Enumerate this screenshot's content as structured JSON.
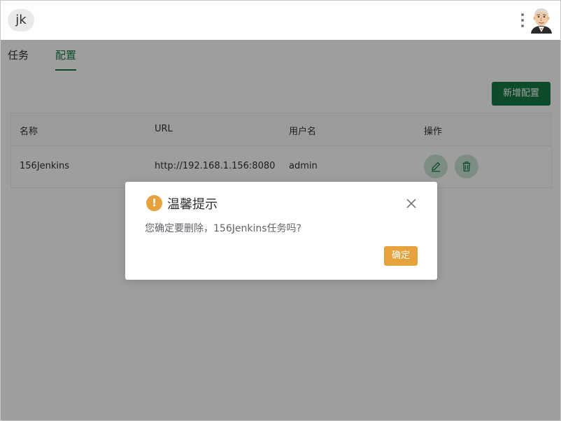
{
  "header": {
    "logo_text": "jk",
    "menu_icon": "vertical-ellipsis-icon",
    "avatar_icon": "jenkins-butler-avatar"
  },
  "tabs": [
    {
      "label": "任务",
      "active": false
    },
    {
      "label": "配置",
      "active": true
    }
  ],
  "toolbar": {
    "add_label": "新增配置"
  },
  "table": {
    "columns": [
      "名称",
      "URL",
      "用户名",
      "操作"
    ],
    "rows": [
      {
        "name": "156Jenkins",
        "url": "http://192.168.1.156:8080",
        "username": "admin",
        "actions": [
          "edit-icon",
          "trash-icon"
        ]
      }
    ]
  },
  "dialog": {
    "title": "温馨提示",
    "message": "您确定要删除，156Jenkins任务吗?",
    "confirm_label": "确定",
    "icon": "warning-icon"
  },
  "colors": {
    "primary": "#157a45",
    "warning": "#e6a23c",
    "icon_button_bg": "#c8e4d4"
  }
}
